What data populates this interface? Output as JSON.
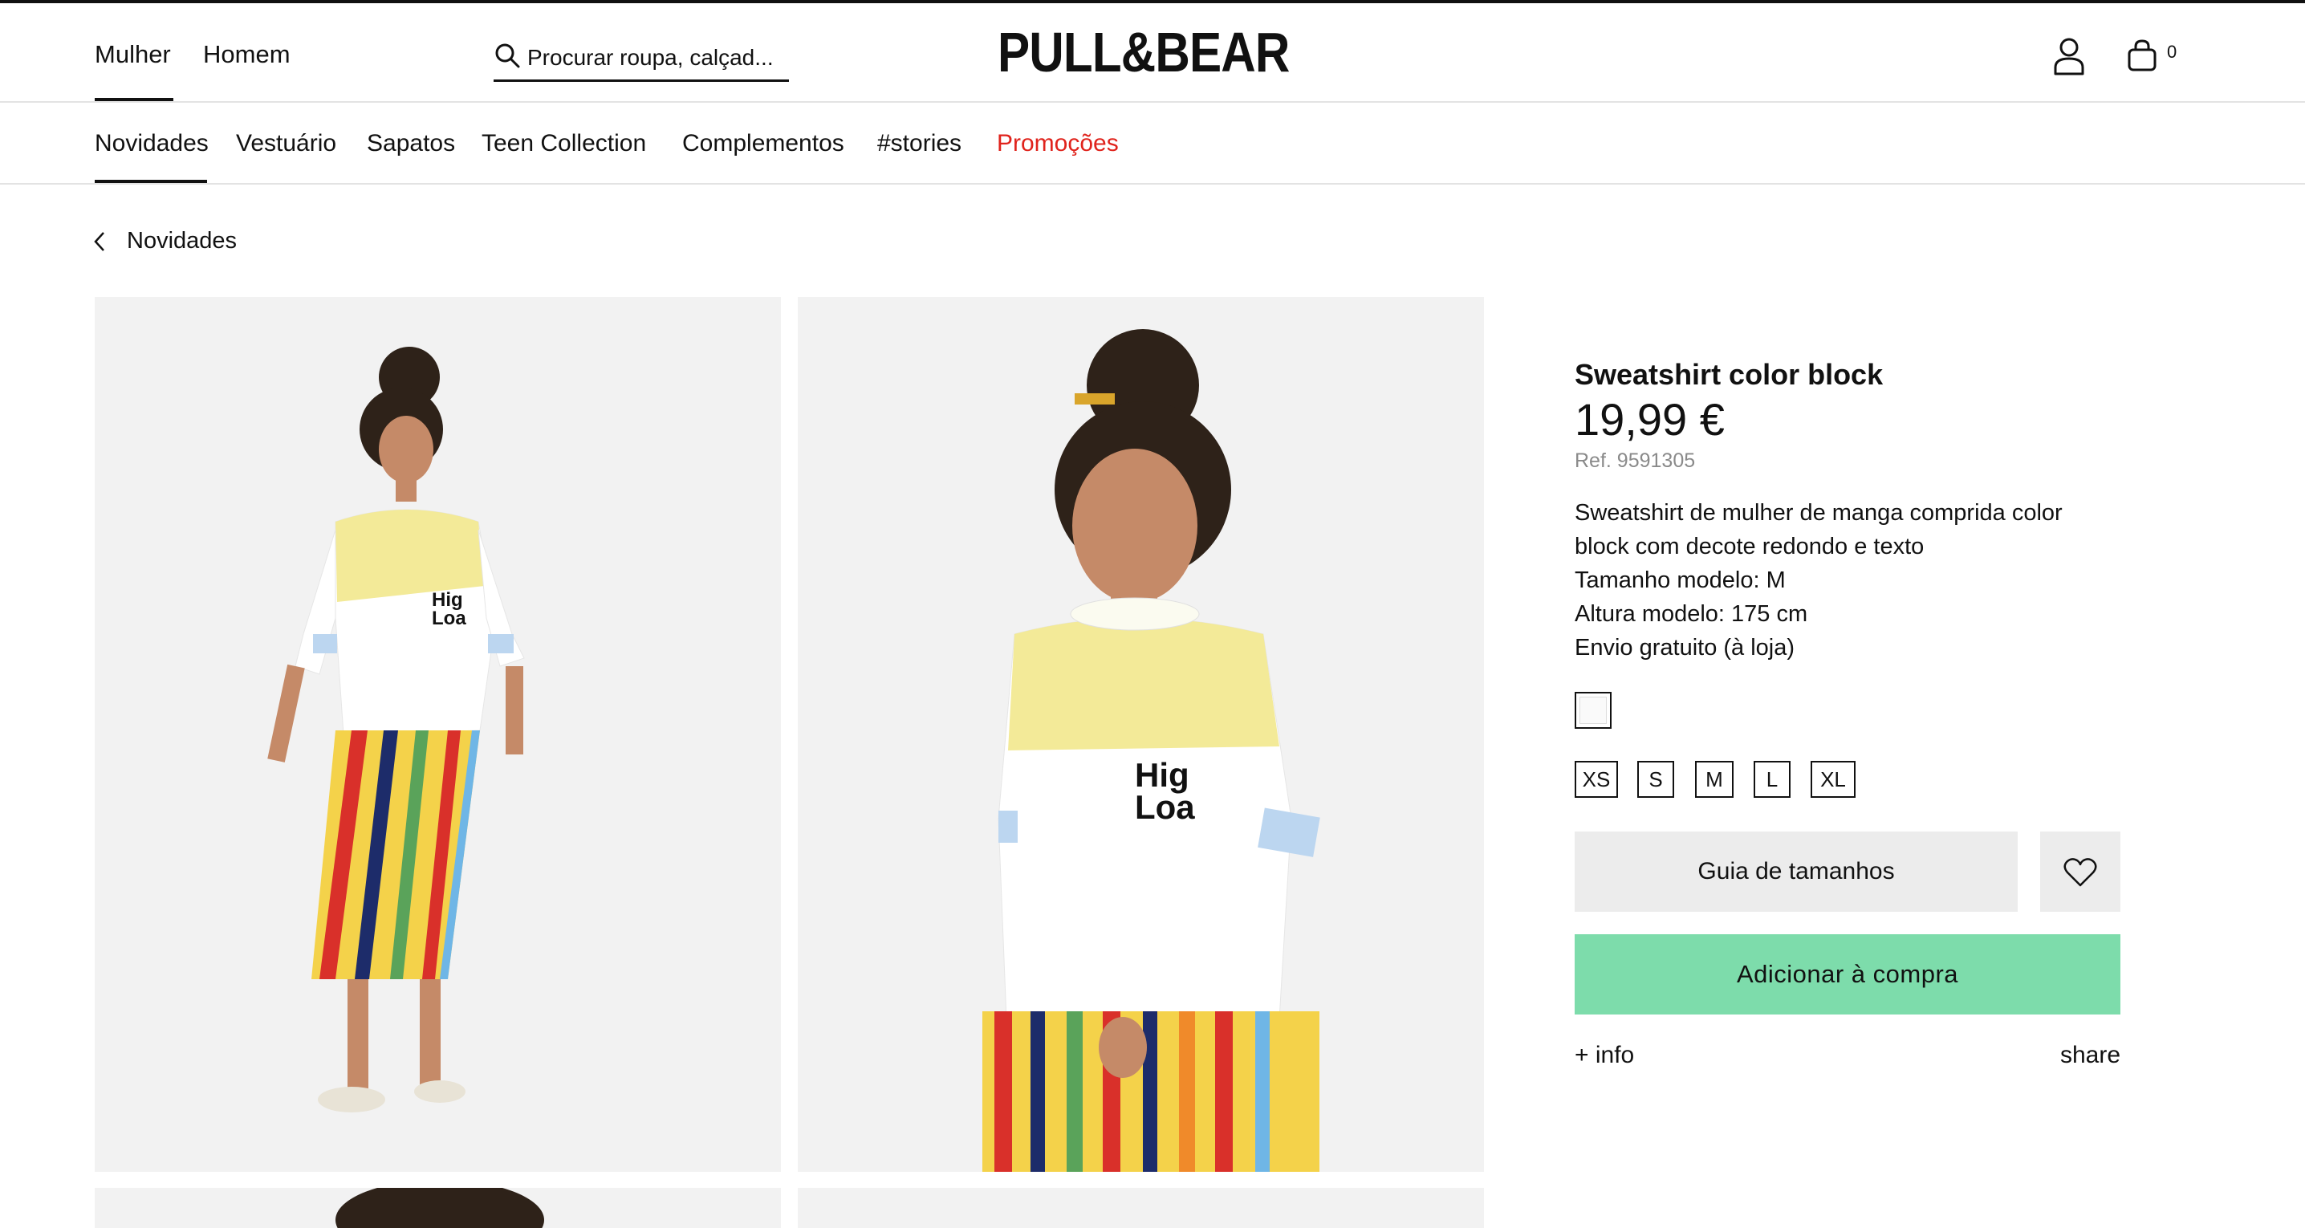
{
  "header": {
    "genders": [
      "Mulher",
      "Homem"
    ],
    "search_placeholder": "Procurar roupa, calçad...",
    "logo": "PULL&BEAR",
    "cart_count": "0",
    "icons": {
      "search": "search-icon",
      "user": "user-icon",
      "bag": "shopping-bag-icon"
    }
  },
  "nav": {
    "items": [
      "Novidades",
      "Vestuário",
      "Sapatos",
      "Teen Collection",
      "Complementos",
      "#stories",
      "Promoções"
    ],
    "active": "Novidades",
    "promo_color": "#e0231c"
  },
  "breadcrumb": {
    "back_label": "Novidades",
    "icon": "chevron-left-icon"
  },
  "product": {
    "title": "Sweatshirt color block",
    "price": "19,99 €",
    "ref": "Ref. 9591305",
    "description_lines": [
      "Sweatshirt de mulher de manga comprida color",
      "block com decote redondo e texto",
      "Tamanho modelo: M",
      "Altura modelo: 175 cm",
      "Envio gratuito (à loja)"
    ],
    "color_swatch": "#fafafa",
    "sizes": [
      "XS",
      "S",
      "M",
      "L",
      "XL"
    ],
    "size_guide_label": "Guia de tamanhos",
    "favorite_icon": "heart-icon",
    "add_to_cart_label": "Adicionar à compra",
    "add_to_cart_color": "#7ddcab",
    "more_info_label": "+ info",
    "share_label": "share"
  }
}
